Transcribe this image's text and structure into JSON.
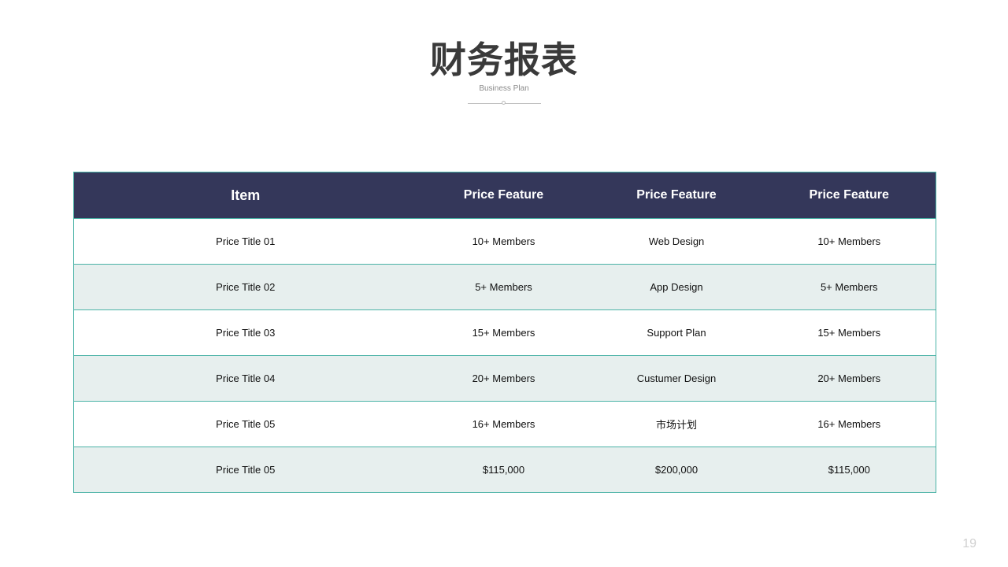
{
  "slide": {
    "title": "财务报表",
    "subtitle": "Business Plan",
    "page_number": "19"
  },
  "table": {
    "headers": [
      "Item",
      "Price Feature",
      "Price Feature",
      "Price Feature"
    ],
    "rows": [
      [
        "Price Title 01",
        "10+ Members",
        "Web Design",
        "10+ Members"
      ],
      [
        "Price Title 02",
        "5+ Members",
        "App Design",
        "5+ Members"
      ],
      [
        "Price Title 03",
        "15+ Members",
        "Support Plan",
        "15+ Members"
      ],
      [
        "Price Title 04",
        "20+ Members",
        "Custumer Design",
        "20+ Members"
      ],
      [
        "Price Title 05",
        "16+ Members",
        "市场计划",
        "16+ Members"
      ],
      [
        "Price Title 05",
        "$115,000",
        "$200,000",
        "$115,000"
      ]
    ]
  },
  "colors": {
    "header_bg": "#34375a",
    "border": "#4bb3a7",
    "stripe": "#e7efee",
    "title": "#3a3a3a"
  }
}
